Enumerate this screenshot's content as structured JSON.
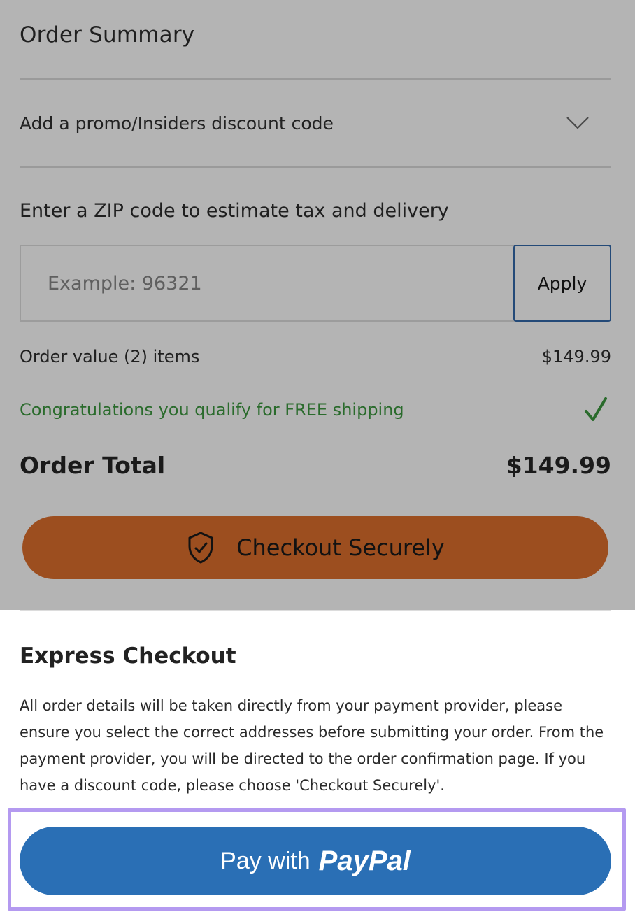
{
  "order_summary": {
    "title": "Order Summary",
    "promo_label": "Add a promo/Insiders discount code",
    "zip_label": "Enter a ZIP code to estimate tax and delivery",
    "zip_placeholder": "Example: 96321",
    "apply_label": "Apply",
    "order_value_label": "Order value (2) items",
    "order_value_amount": "$149.99",
    "shipping_message": "Congratulations you qualify for FREE shipping",
    "order_total_label": "Order Total",
    "order_total_amount": "$149.99",
    "checkout_label": "Checkout Securely"
  },
  "express": {
    "title": "Express Checkout",
    "description": "All order details will be taken directly from your payment provider, please ensure you select the correct addresses before submitting your order. From the payment provider, you will be directed to the order confirmation page. If you have a discount code, please choose 'Checkout Securely'.",
    "paypal_prefix": "Pay with",
    "paypal_brand": "PayPal"
  },
  "colors": {
    "overlay": "#b4b4b4",
    "checkout_button": "#9c4e1f",
    "paypal_button": "#2a6fb5",
    "success_green": "#2a6b2c",
    "highlight_border": "#b49af0"
  }
}
